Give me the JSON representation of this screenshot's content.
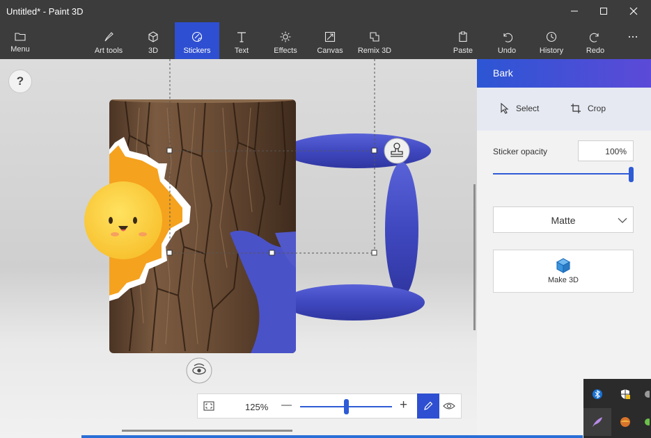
{
  "window": {
    "title": "Untitled* - Paint 3D"
  },
  "toolbar": {
    "menu": "Menu",
    "art_tools": "Art tools",
    "three_d": "3D",
    "stickers": "Stickers",
    "text": "Text",
    "effects": "Effects",
    "canvas": "Canvas",
    "remix": "Remix 3D",
    "paste": "Paste",
    "undo": "Undo",
    "history": "History",
    "redo": "Redo",
    "active": "Stickers"
  },
  "canvas": {
    "help": "?"
  },
  "zoom": {
    "level": "125%",
    "minus": "—",
    "plus": "+"
  },
  "panel": {
    "title": "Bark",
    "select": "Select",
    "crop": "Crop",
    "opacity_label": "Sticker opacity",
    "opacity_value": "100%",
    "opacity_fraction": 1.0,
    "finish": "Matte",
    "make3d": "Make 3D"
  },
  "colors": {
    "accent": "#2e4fd1",
    "titlebar": "#3c3c3c",
    "mug_handle": "#4a52c8"
  }
}
